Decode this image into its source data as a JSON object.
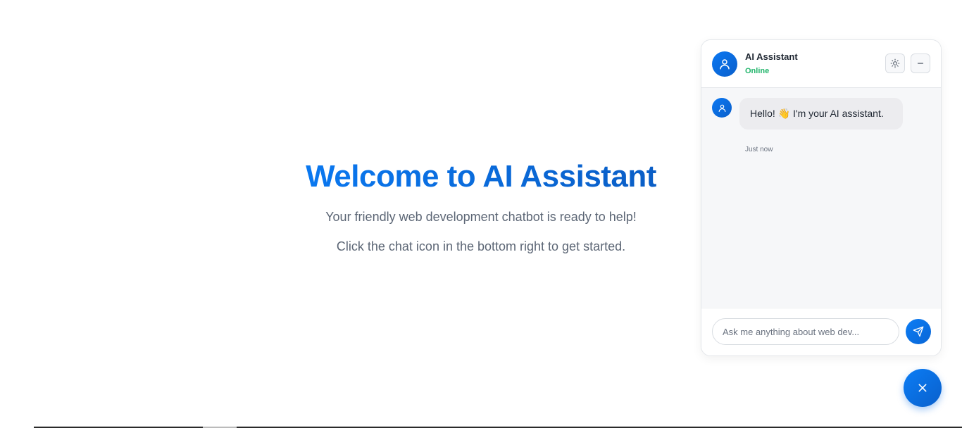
{
  "hero": {
    "title": "Welcome to AI Assistant",
    "subtitle": "Your friendly web development chatbot is ready to help!",
    "hint": "Click the chat icon in the bottom right to get started."
  },
  "chat": {
    "header": {
      "name": "AI Assistant",
      "status": "Online",
      "status_color": "#21b56b",
      "avatar_icon": "user-icon",
      "theme_icon": "sun-icon",
      "minimize_icon": "minus-icon"
    },
    "messages": [
      {
        "sender": "bot",
        "text": "Hello! 👋 I'm your AI assistant.",
        "time": "Just now"
      }
    ],
    "input": {
      "placeholder": "Ask me anything about web dev...",
      "value": ""
    },
    "send_icon": "send-icon"
  },
  "fab": {
    "icon": "close-icon"
  },
  "colors": {
    "accent": "#0a72e0",
    "text_muted": "#5c6675"
  }
}
